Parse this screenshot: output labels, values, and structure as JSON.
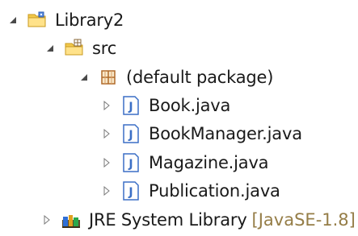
{
  "tree": {
    "project": {
      "label": "Library2",
      "icon": "project-folder-icon",
      "expanded": true
    },
    "src_folder": {
      "label": "src",
      "icon": "source-folder-icon",
      "expanded": true
    },
    "package": {
      "label": "(default package)",
      "icon": "package-icon",
      "expanded": true
    },
    "files": [
      {
        "label": "Book.java",
        "icon": "java-file-icon"
      },
      {
        "label": "BookManager.java",
        "icon": "java-file-icon"
      },
      {
        "label": "Magazine.java",
        "icon": "java-file-icon"
      },
      {
        "label": "Publication.java",
        "icon": "java-file-icon"
      }
    ],
    "jre": {
      "label": "JRE System Library",
      "decoration": "[JavaSE-1.8]",
      "icon": "library-books-icon",
      "expanded": false
    }
  },
  "colors": {
    "decoration": "#957d47",
    "java_icon_blue": "#3b6fc6",
    "package_brown": "#8a6a3a",
    "folder_yellow": "#f2c94c"
  }
}
